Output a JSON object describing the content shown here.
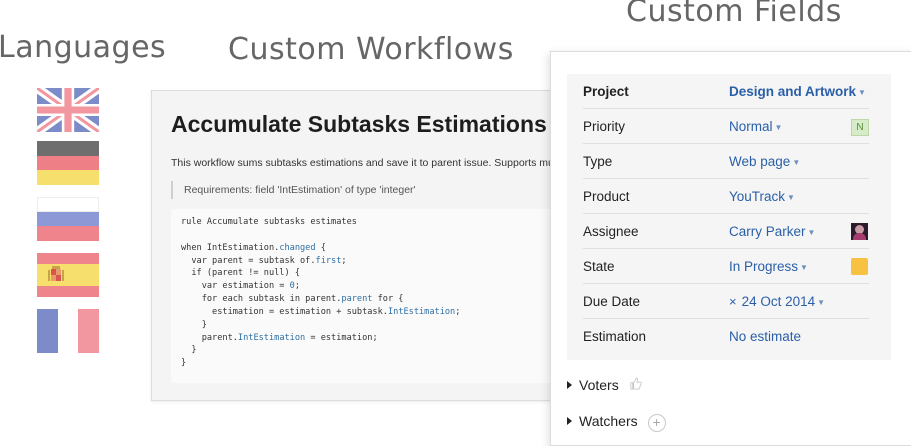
{
  "headings": {
    "languages": "Languages",
    "workflows": "Custom Workflows",
    "fields": "Custom Fields"
  },
  "flags": [
    {
      "name": "uk-flag-icon",
      "colors": [
        "#7b8cc8",
        "#f2969f",
        "#ffffff"
      ]
    },
    {
      "name": "germany-flag-icon",
      "colors": [
        "#6e6e6e",
        "#ee7f86",
        "#f7df6e"
      ]
    },
    {
      "name": "russia-flag-icon",
      "colors": [
        "#ffffff",
        "#8c99d6",
        "#f0848c"
      ]
    },
    {
      "name": "spain-flag-icon",
      "colors": [
        "#f0848c",
        "#f7df6e",
        "#f0848c"
      ]
    },
    {
      "name": "france-flag-icon",
      "colors": [
        "#7b8cc8",
        "#ffffff",
        "#f2969f"
      ]
    }
  ],
  "workflow": {
    "title": "Accumulate Subtasks Estimations",
    "description": "This workflow sums subtasks estimations and save it to parent issue. Supports mu",
    "requirements": "Requirements: field 'IntEstimation' of type 'integer'",
    "code_lines": [
      "rule Accumulate subtasks estimates",
      "",
      "when IntEstimation.changed {",
      "  var parent = subtask of.first;",
      "  if (parent != null) {",
      "    var estimation = 0;",
      "    for each subtask in parent.parent for {",
      "      estimation = estimation + subtask.IntEstimation;",
      "    }",
      "    parent.IntEstimation = estimation;",
      "  }",
      "}"
    ]
  },
  "fields": {
    "rows": [
      {
        "label": "Project",
        "value": "Design and Artwork",
        "dropdown": true
      },
      {
        "label": "Priority",
        "value": "Normal",
        "dropdown": true,
        "badge": "N"
      },
      {
        "label": "Type",
        "value": "Web page",
        "dropdown": true
      },
      {
        "label": "Product",
        "value": "YouTrack",
        "dropdown": true
      },
      {
        "label": "Assignee",
        "value": "Carry Parker",
        "dropdown": true
      },
      {
        "label": "State",
        "value": "In Progress",
        "dropdown": true,
        "color": "#f7c242"
      },
      {
        "label": "Due Date",
        "value": "24 Oct 2014",
        "dropdown": true,
        "clear": "×"
      },
      {
        "label": "Estimation",
        "value": "No estimate",
        "dropdown": false
      }
    ],
    "voters_label": "Voters",
    "watchers_label": "Watchers",
    "plus_symbol": "+"
  }
}
